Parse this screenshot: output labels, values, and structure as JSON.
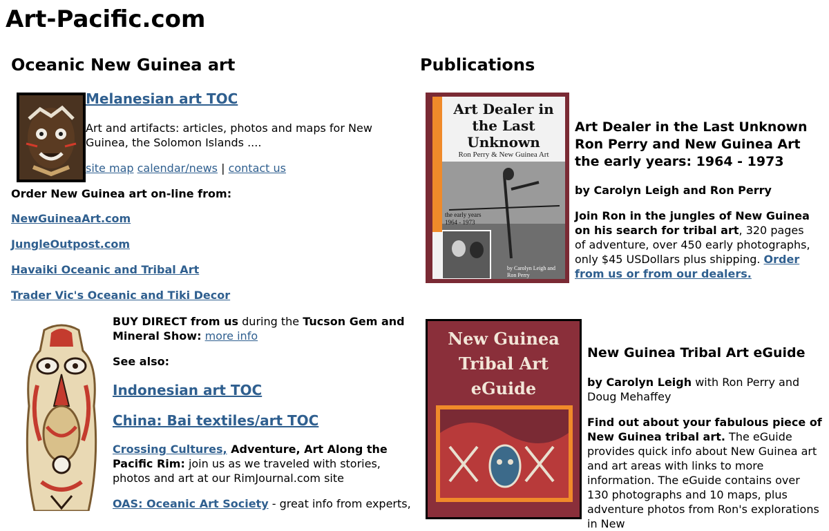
{
  "site": {
    "title": "Art-Pacific.com"
  },
  "left": {
    "heading": "Oceanic New Guinea art",
    "toc": {
      "title": "Melanesian art TOC",
      "desc": "Art and artifacts: articles, photos and maps for New Guinea, the Solomon Islands ....",
      "links": {
        "sitemap": "site map",
        "calendar": "calendar/news",
        "sep": " | ",
        "contact": "contact us"
      }
    },
    "order_label": "Order New Guinea art on-line from:",
    "shop_links": [
      "NewGuineaArt.com",
      "JungleOutpost.com",
      "Havaiki Oceanic and Tribal Art",
      "Trader Vic's Oceanic and Tiki Decor"
    ],
    "buy_direct": {
      "bold1": "BUY DIRECT from us",
      "text1": " during the ",
      "bold2": "Tucson Gem and Mineral Show:",
      "link": "more info"
    },
    "see_also": "See also:",
    "see_links": [
      "Indonesian art TOC",
      "China: Bai textiles/art TOC"
    ],
    "crossing": {
      "link": "Crossing Cultures,",
      "bold": " Adventure, Art Along the Pacific Rim:",
      "text": " join us as we traveled with stories, photos and art at our RimJournal.com site"
    },
    "oas": {
      "link": "OAS: Oceanic Art Society",
      "text": " - great info from experts,"
    }
  },
  "right": {
    "heading": "Publications",
    "book1": {
      "cover_title": "Art Dealer in the Last Unknown",
      "cover_sub": "Ron Perry & New Guinea Art",
      "cover_years": "the early years 1964 - 1973",
      "cover_by": "by Carolyn Leigh and Ron Perry",
      "title_lines": [
        "Art Dealer in the Last Unknown",
        "Ron Perry and New Guinea Art",
        "the early years: 1964 - 1973"
      ],
      "by": "by Carolyn Leigh and Ron Perry",
      "blurb_bold": "Join Ron in the jungles of New Guinea on his search for tribal art",
      "blurb_text": ", 320 pages of adventure, over 450 early photographs, only $45 USDollars plus shipping. ",
      "blurb_link": "Order from us or from our dealers."
    },
    "book2": {
      "cover_title": "New Guinea Tribal Art eGuide",
      "title": "New Guinea Tribal Art eGuide",
      "by_bold": "by Carolyn Leigh",
      "by_text": " with Ron Perry and Doug Mehaffey",
      "blurb_bold": "Find out about your fabulous piece of New Guinea tribal art.",
      "blurb_text": " The eGuide provides quick info about New Guinea art and art areas with links to more information. The eGuide contains over 130 photographs and 10 maps, plus adventure photos from Ron's explorations in New"
    }
  }
}
